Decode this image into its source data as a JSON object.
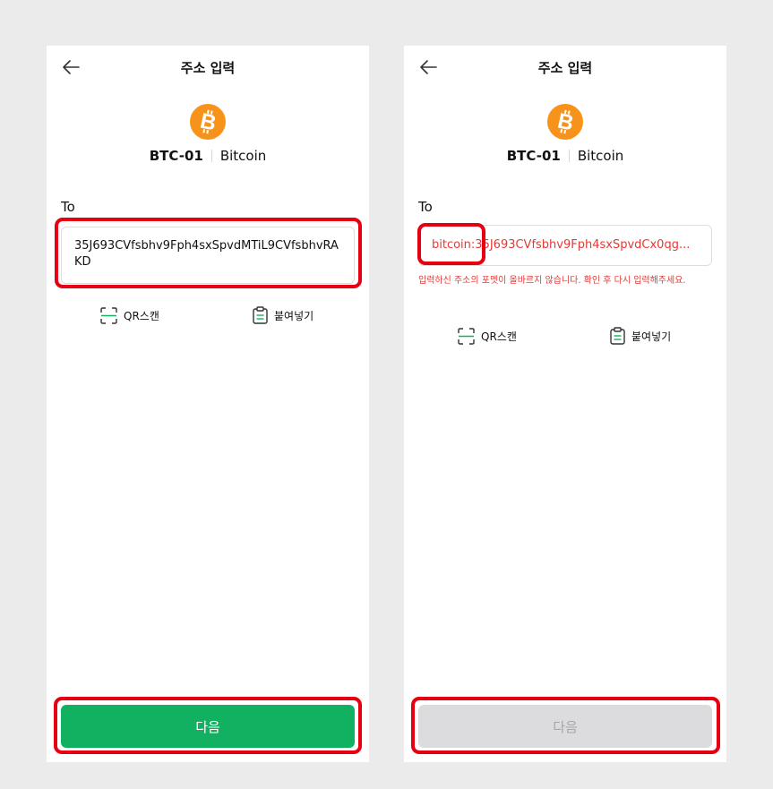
{
  "screens": [
    {
      "title": "주소 입력",
      "coin": {
        "code": "BTC-01",
        "name": "Bitcoin",
        "icon": "bitcoin-logo-icon",
        "color": "#f7931a"
      },
      "to_label": "To",
      "address_value": "35J693CVfsbhv9Fph4sxSpvdMTiL9CVfsbhvRAKD",
      "actions": {
        "qr_label": "QR스캔",
        "paste_label": "붙여넣기"
      },
      "next_label": "다음",
      "next_enabled": true,
      "next_color": "#12b161"
    },
    {
      "title": "주소 입력",
      "coin": {
        "code": "BTC-01",
        "name": "Bitcoin",
        "icon": "bitcoin-logo-icon",
        "color": "#f7931a"
      },
      "to_label": "To",
      "address_value": "bitcoin:35J693CVfsbhv9Fph4sxSpvdCx0qg...",
      "error_text": "입력하신 주소의 포멧이 올바르지 않습니다. 확인 후 다시 입력해주세요.",
      "error_color": "#e53935",
      "actions": {
        "qr_label": "QR스캔",
        "paste_label": "붙여넣기"
      },
      "next_label": "다음",
      "next_enabled": false,
      "next_color": "#dcdcde"
    }
  ],
  "highlight_color": "#e60012"
}
